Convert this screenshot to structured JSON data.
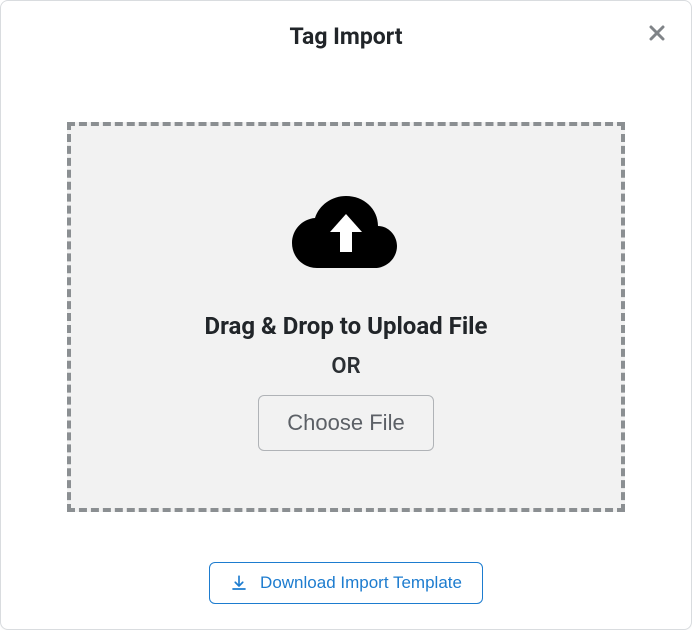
{
  "header": {
    "title": "Tag Import"
  },
  "dropzone": {
    "line1": "Drag & Drop to Upload File",
    "line2": "OR",
    "choose_label": "Choose File"
  },
  "footer": {
    "download_label": "Download Import Template"
  }
}
